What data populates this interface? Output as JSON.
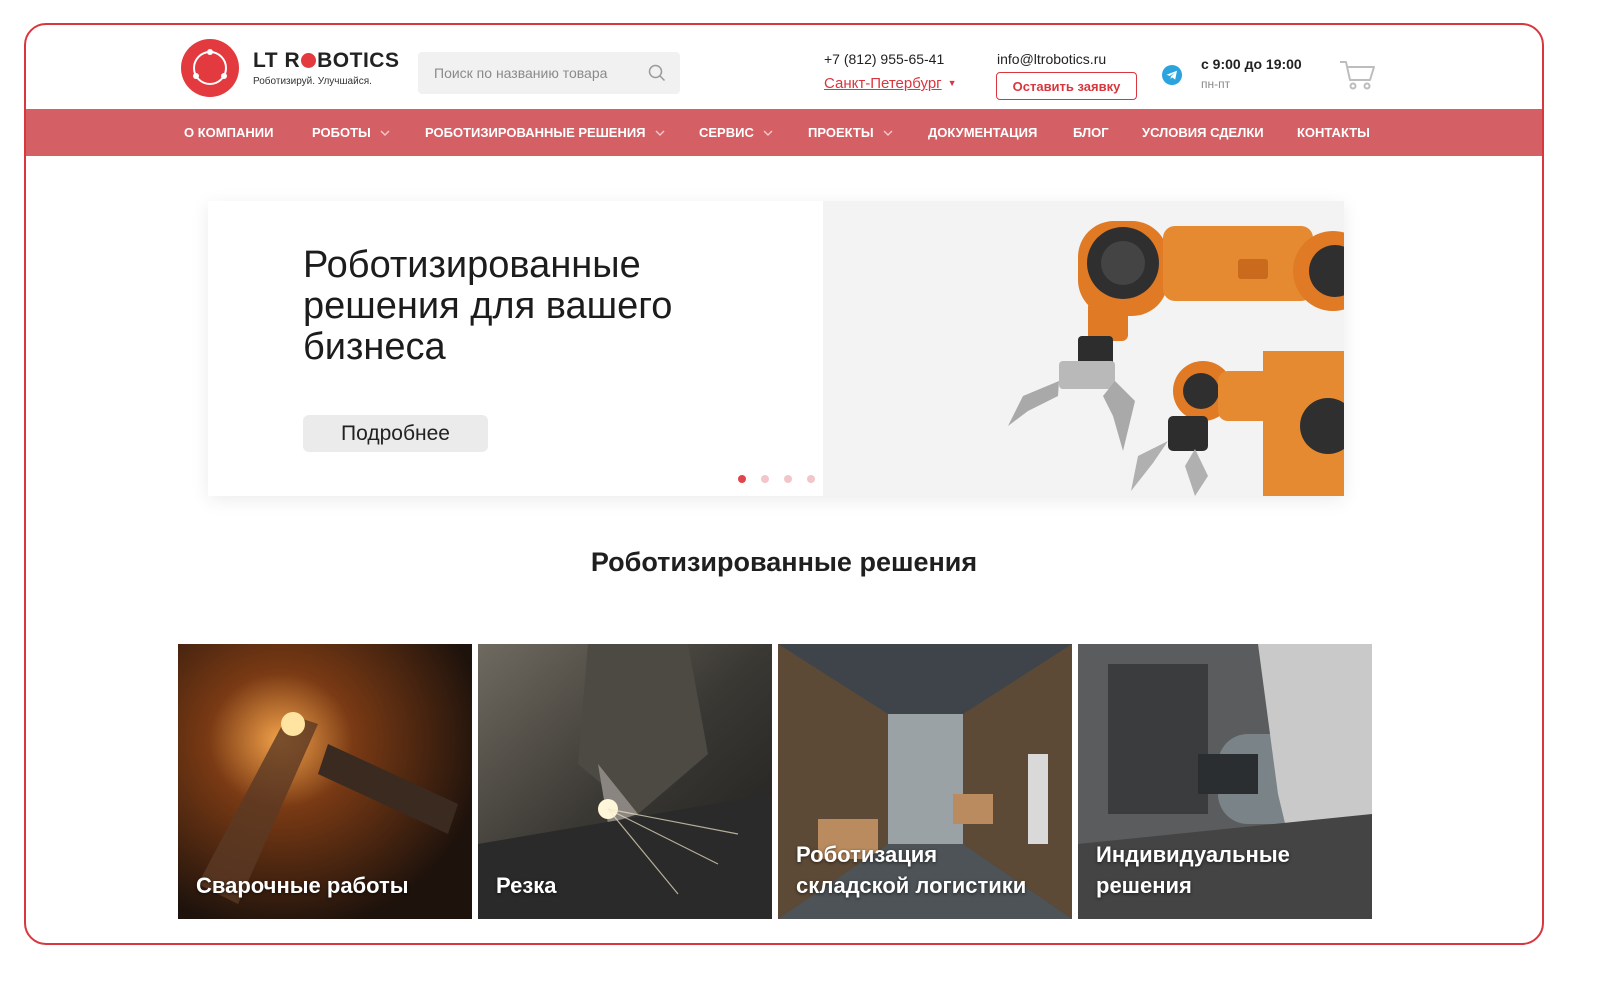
{
  "brand": {
    "name_left": "LT",
    "name_right": "R",
    "name_rest": "BOTICS",
    "tagline": "Роботизируй. Улучшайся.",
    "accent_color": "#d9363e"
  },
  "search": {
    "placeholder": "Поиск по названию товара",
    "icon": "search-icon"
  },
  "contacts": {
    "phone": "+7 (812) 955-65-41",
    "city": "Санкт-Петербург",
    "email": "info@ltrobotics.ru",
    "request_button": "Оставить заявку",
    "hours": "с 9:00 до 19:00",
    "days": "пн-пт"
  },
  "nav": {
    "items": [
      {
        "label": "О КОМПАНИИ",
        "dropdown": false
      },
      {
        "label": "РОБОТЫ",
        "dropdown": true
      },
      {
        "label": "РОБОТИЗИРОВАННЫЕ РЕШЕНИЯ",
        "dropdown": true
      },
      {
        "label": "СЕРВИС",
        "dropdown": true
      },
      {
        "label": "ПРОЕКТЫ",
        "dropdown": true
      },
      {
        "label": "ДОКУМЕНТАЦИЯ",
        "dropdown": false
      },
      {
        "label": "БЛОГ",
        "dropdown": false
      },
      {
        "label": "УСЛОВИЯ СДЕЛКИ",
        "dropdown": false
      },
      {
        "label": "КОНТАКТЫ",
        "dropdown": false
      }
    ],
    "background": "#d46065"
  },
  "hero": {
    "title": "Роботизированные решения для вашего бизнеса",
    "button": "Подробнее",
    "slides_total": 4,
    "active_slide": 1
  },
  "solutions": {
    "title": "Роботизированные решения",
    "cards": [
      {
        "label": "Сварочные работы"
      },
      {
        "label": "Резка"
      },
      {
        "label": "Роботизация складской логистики"
      },
      {
        "label": "Индивидуальные решения"
      }
    ]
  }
}
